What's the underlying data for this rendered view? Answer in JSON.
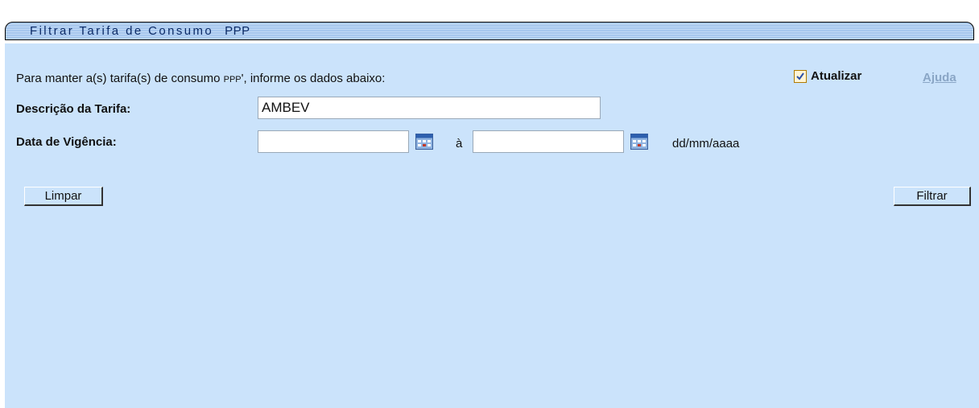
{
  "page": {
    "title": "Filtrar Tarifa de Consumo",
    "title_tag": "PPP",
    "instruction_prefix": "Para manter a(s) tarifa(s) de consumo",
    "instruction_tag": "PPP",
    "instruction_suffix": "', informe os dados abaixo:",
    "atualizar_label": "Atualizar",
    "atualizar_checked": true,
    "ajuda_label": "Ajuda"
  },
  "form": {
    "descricao_label": "Descrição da Tarifa:",
    "descricao_value": "AMBEV",
    "data_label": "Data de Vigência:",
    "data_inicio_value": "",
    "data_separator": "à",
    "data_fim_value": "",
    "date_format_hint": "dd/mm/aaaa"
  },
  "buttons": {
    "limpar_label": "Limpar",
    "filtrar_label": "Filtrar"
  },
  "icons": {
    "calendar": "calendar-icon",
    "checkbox": "checkmark-icon"
  },
  "colors": {
    "background": "#cbe3fb",
    "title_bar": "#a7c7ee",
    "title_text": "#0b2a66",
    "link": "#8aa6c6"
  }
}
